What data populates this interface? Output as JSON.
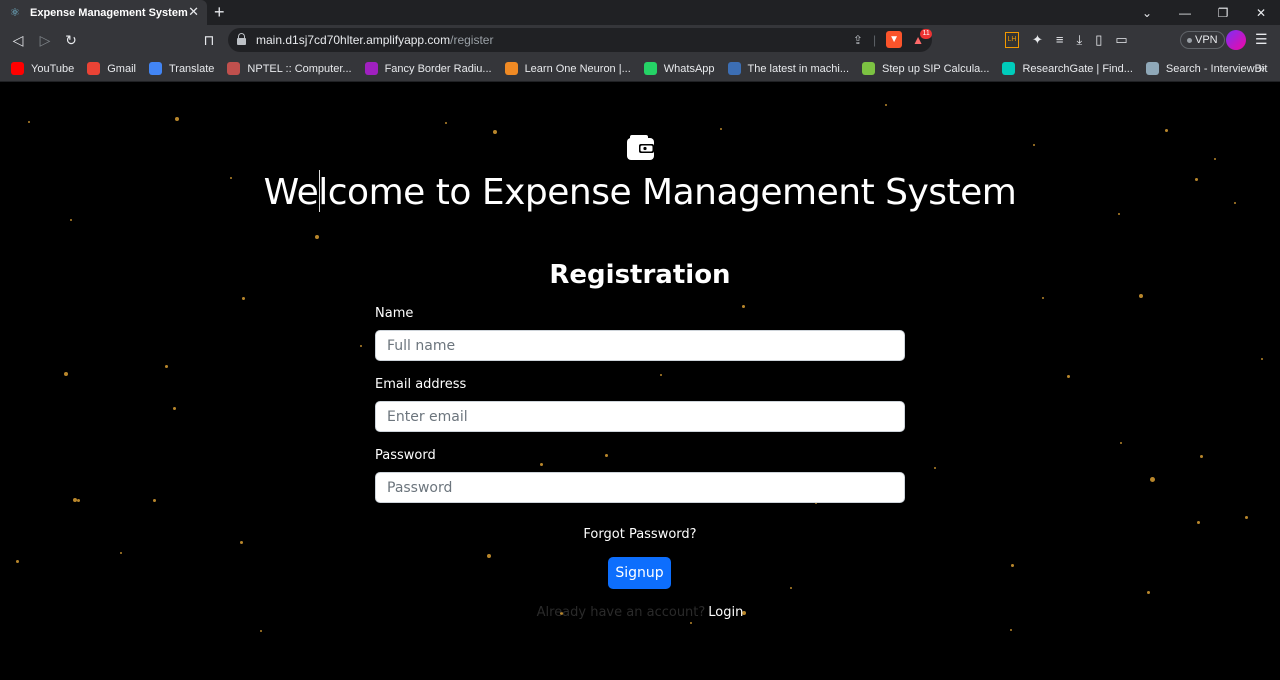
{
  "browser": {
    "tab_title": "Expense Management System",
    "url_host": "main.d1sj7cd70hlter.amplifyapp.com",
    "url_path": "/register",
    "rewards_badge": "11",
    "vpn_label": "VPN",
    "bookmarks": [
      {
        "label": "YouTube",
        "icon": "youtube-icon",
        "color": "#ff0000"
      },
      {
        "label": "Gmail",
        "icon": "gmail-icon",
        "color": "#ea4335"
      },
      {
        "label": "Translate",
        "icon": "translate-icon",
        "color": "#4285f4"
      },
      {
        "label": "NPTEL :: Computer...",
        "icon": "nptel-icon",
        "color": "#c0504d"
      },
      {
        "label": "Fancy Border Radiu...",
        "icon": "fancy-border-icon",
        "color": "#a020c0"
      },
      {
        "label": "Learn One Neuron |...",
        "icon": "oneneuron-icon",
        "color": "#f08a24"
      },
      {
        "label": "WhatsApp",
        "icon": "whatsapp-icon",
        "color": "#25d366"
      },
      {
        "label": "The latest in machi...",
        "icon": "paperswithcode-icon",
        "color": "#3c6eb4"
      },
      {
        "label": "Step up SIP Calcula...",
        "icon": "sip-icon",
        "color": "#7cc242"
      },
      {
        "label": "ResearchGate | Find...",
        "icon": "researchgate-icon",
        "color": "#00ccbb"
      },
      {
        "label": "Search - InterviewBit",
        "icon": "interviewbit-icon",
        "color": "#8fa8b8"
      }
    ]
  },
  "page": {
    "heading": "Welcome to Expense Management System",
    "form_title": "Registration",
    "name_label": "Name",
    "name_placeholder": "Full name",
    "email_label": "Email address",
    "email_placeholder": "Enter email",
    "password_label": "Password",
    "password_placeholder": "Password",
    "forgot_password": "Forgot Password?",
    "signup_label": "Signup",
    "login_prompt": "Already have an account?",
    "login_link": "Login"
  },
  "colors": {
    "background": "#000000",
    "primary_button": "#0d6efd",
    "star": "#b8862b"
  }
}
